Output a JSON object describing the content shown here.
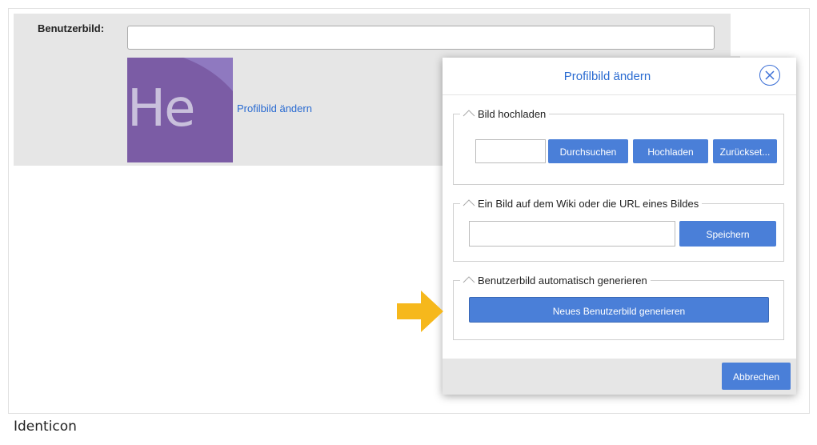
{
  "form": {
    "label": "Benutzerbild:",
    "input_value": "",
    "avatar_text": "He",
    "change_link": "Profilbild ändern"
  },
  "dialog": {
    "title": "Profilbild ändern",
    "upload_section": {
      "legend": "Bild hochladen",
      "browse_label": "Durchsuchen",
      "upload_label": "Hochladen",
      "reset_label": "Zurückset..."
    },
    "url_section": {
      "legend": "Ein Bild auf dem Wiki oder die URL eines Bildes",
      "save_label": "Speichern"
    },
    "generate_section": {
      "legend": "Benutzerbild automatisch generieren",
      "generate_label": "Neues Benutzerbild generieren"
    },
    "cancel_label": "Abbrechen"
  },
  "caption": "Identicon",
  "colors": {
    "accent": "#4a7fd8",
    "link": "#2a6bd1",
    "avatar_bg": "#7b5ca5",
    "arrow": "#f6b81c"
  }
}
